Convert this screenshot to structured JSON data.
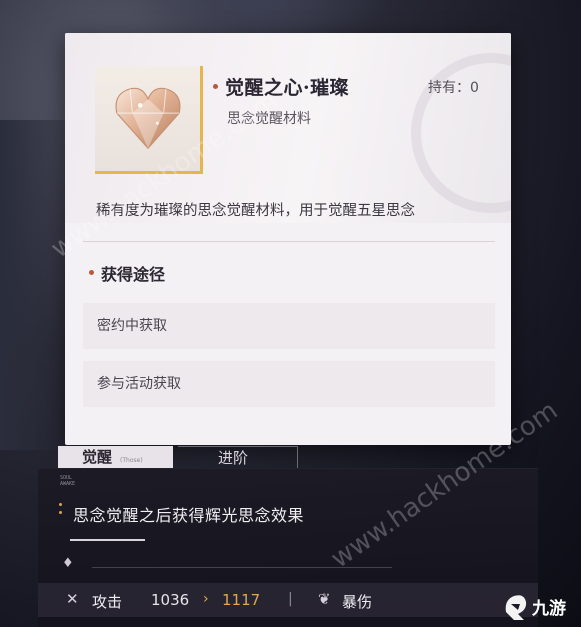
{
  "item": {
    "title": "觉醒之心·璀璨",
    "subtitle": "思念觉醒材料",
    "owned": "持有：0",
    "description": "稀有度为璀璨的思念觉醒材料，用于觉醒五星思念",
    "icon": "heart-diamond-icon"
  },
  "sources": {
    "title": "获得途径",
    "items": [
      {
        "label": "密约中获取"
      },
      {
        "label": "参与活动获取"
      }
    ]
  },
  "tabs": [
    {
      "label": "觉醒",
      "tag": "(Those)"
    },
    {
      "label": "进阶"
    }
  ],
  "panel": {
    "tag_line1": "SOUL",
    "tag_line2": "AWAKE",
    "effect": "思念觉醒之后获得辉光思念效果"
  },
  "stats": {
    "attack_label": "攻击",
    "attack_old": "1036",
    "arrow": "›",
    "attack_new": "1117",
    "separator": "|",
    "crit_label": "暴伤"
  },
  "watermark": "www.hackhome.com",
  "logo_text": "九游",
  "colors": {
    "accent_dot": "#b8593e",
    "gold": "#e6b64c",
    "stat_increase": "#e3a74a"
  }
}
